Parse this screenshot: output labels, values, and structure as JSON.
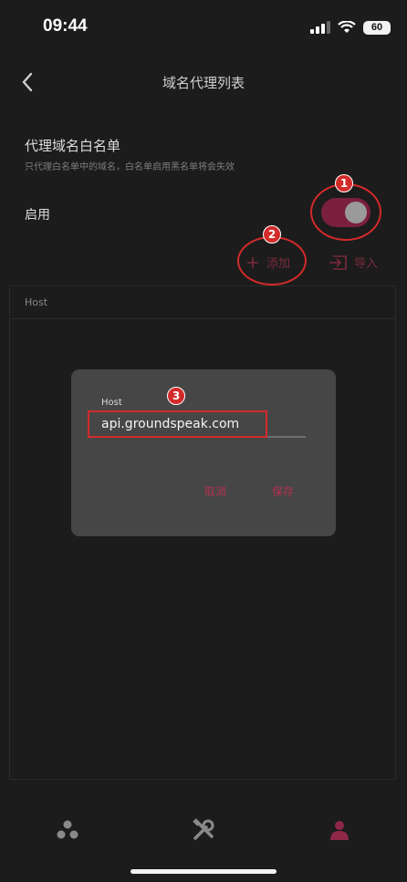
{
  "status": {
    "time": "09:44",
    "battery": "60"
  },
  "nav": {
    "title": "域名代理列表"
  },
  "whitelist": {
    "title": "代理域名白名单",
    "description": "只代理白名单中的域名，白名单启用黑名单将会失效",
    "enable_label": "启用",
    "enabled": true
  },
  "actions": {
    "add_label": "添加",
    "import_label": "导入"
  },
  "table": {
    "columns": [
      "Host"
    ]
  },
  "dialog": {
    "field_label": "Host",
    "field_value": "api.groundspeak.com",
    "cancel_label": "取消",
    "save_label": "保存"
  },
  "annotations": {
    "badges": [
      "1",
      "2",
      "3"
    ],
    "color": "#d32a2a"
  },
  "colors": {
    "accent": "#7a1f3d",
    "button_text": "#b3314f",
    "background": "#1c1c1c"
  }
}
